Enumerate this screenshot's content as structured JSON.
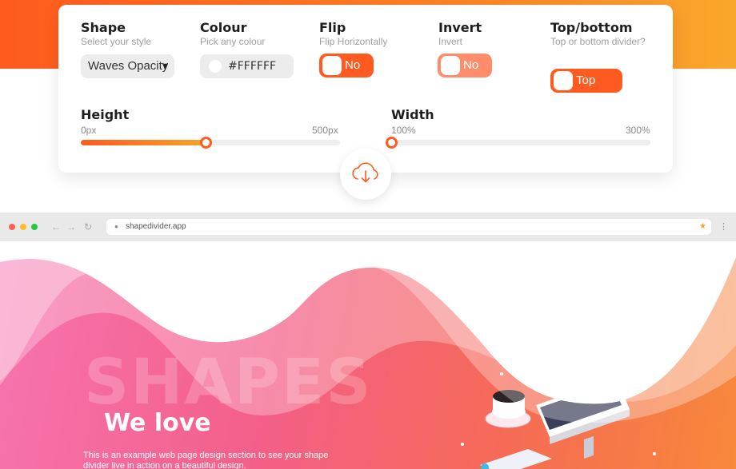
{
  "controls": {
    "shape": {
      "title": "Shape",
      "subtitle": "Select your style",
      "value": "Waves Opacity"
    },
    "colour": {
      "title": "Colour",
      "subtitle": "Pick any colour",
      "value": "#FFFFFF"
    },
    "flip": {
      "title": "Flip",
      "subtitle": "Flip Horizontally",
      "toggle": "No"
    },
    "invert": {
      "title": "Invert",
      "subtitle": "Invert",
      "toggle": "No"
    },
    "position": {
      "title": "Top/bottom",
      "subtitle": "Top or bottom divider?",
      "toggle": "Top"
    }
  },
  "sliders": {
    "height": {
      "title": "Height",
      "min": "0px",
      "max": "500px",
      "level": 0.48
    },
    "width": {
      "title": "Width",
      "min": "100%",
      "max": "300%",
      "level": 0.0
    }
  },
  "icons": {
    "download": "cloud-download-icon",
    "back": "arrow-left-icon",
    "forward": "arrow-right-icon",
    "reload": "reload-icon",
    "lock": "lock-icon",
    "bookmark": "star-icon",
    "menu": "more-vertical-icon"
  },
  "browser": {
    "url": "shapedivider.app"
  },
  "hero": {
    "background_word": "SHAPES",
    "heading": "We love",
    "body": "This is an example web page design section to see your shape divider live in action on a beautiful design."
  },
  "colors": {
    "accent": "#ff5a1f",
    "accent_light": "#ff8d6b",
    "accent_end": "#f9a72c",
    "track": "#eeeeee"
  }
}
